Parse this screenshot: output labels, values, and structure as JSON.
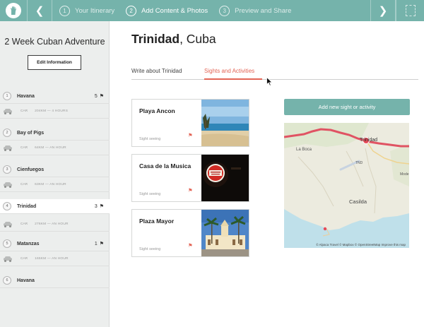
{
  "topbar": {
    "logo_icon": "hand-icon",
    "prev_icon": "chevron-left-icon",
    "next_icon": "chevron-right-icon",
    "steps": [
      {
        "num": "1",
        "label": "Your Itinerary",
        "active": false
      },
      {
        "num": "2",
        "label": "Add Content & Photos",
        "active": true
      },
      {
        "num": "3",
        "label": "Preview and Share",
        "active": false
      }
    ],
    "accent": "#75b3ab"
  },
  "sidebar": {
    "trip_title": "2 Week Cuban Adventure",
    "edit_label": "Edit Information",
    "destinations": [
      {
        "num": "1",
        "name": "Havana",
        "count": "5",
        "flag": true,
        "active": false
      },
      {
        "num": "2",
        "name": "Bay of Pigs",
        "count": "",
        "flag": false,
        "active": false
      },
      {
        "num": "3",
        "name": "Cienfuegos",
        "count": "",
        "flag": false,
        "active": false
      },
      {
        "num": "4",
        "name": "Trinidad",
        "count": "3",
        "flag": true,
        "active": true
      },
      {
        "num": "5",
        "name": "Matanzas",
        "count": "1",
        "flag": true,
        "active": false
      },
      {
        "num": "6",
        "name": "Havana",
        "count": "",
        "flag": false,
        "active": false
      }
    ],
    "travels": [
      {
        "mode": "CAR",
        "info": "204KM — 4 HOURS"
      },
      {
        "mode": "CAR",
        "info": "64KM — AN HOUR"
      },
      {
        "mode": "CAR",
        "info": "63KM — AN HOUR"
      },
      {
        "mode": "CAR",
        "info": "276KM — AN HOUR"
      },
      {
        "mode": "CAR",
        "info": "165KM — AN HOUR"
      }
    ]
  },
  "main": {
    "title_bold": "Trinidad",
    "title_rest": ", Cuba",
    "tabs": [
      {
        "label": "Write about Trinidad",
        "active": false
      },
      {
        "label": "Sights and Activities",
        "active": true
      }
    ],
    "accent": "#e36455",
    "cards": [
      {
        "name": "Playa Ancon",
        "category": "Sight seeing"
      },
      {
        "name": "Casa de la Musica",
        "category": "Sight seeing"
      },
      {
        "name": "Plaza Mayor",
        "category": "Sight seeing"
      }
    ],
    "add_button": "Add new sight or activity",
    "map": {
      "labels": [
        "Trinidad",
        "La Boca",
        "TND",
        "Casilda",
        "Mode"
      ],
      "attribution": "© Alpaca Travel  © Mapbox  © OpenStreetMap  Improve this map"
    }
  }
}
